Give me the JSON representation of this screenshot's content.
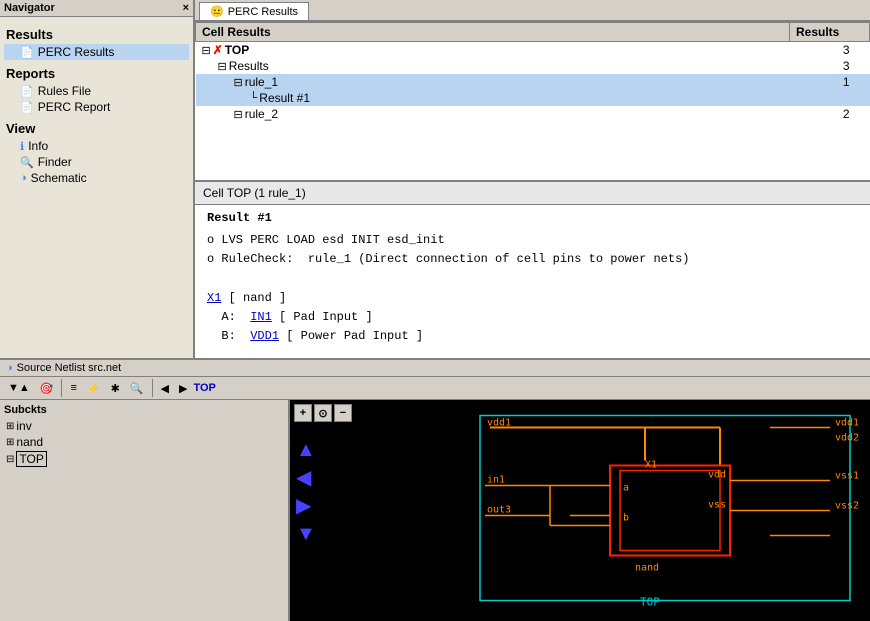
{
  "navigator": {
    "title": "Navigator",
    "close_label": "×",
    "sections": {
      "results_header": "Results",
      "results_items": [
        {
          "id": "perc-results",
          "label": "PERC Results",
          "indent": 1
        }
      ],
      "reports_header": "Reports",
      "reports_items": [
        {
          "id": "rules-file",
          "label": "Rules File",
          "indent": 1
        },
        {
          "id": "perc-report",
          "label": "PERC Report",
          "indent": 1
        }
      ],
      "view_header": "View",
      "view_items": [
        {
          "id": "info",
          "label": "Info",
          "icon": "ℹ",
          "indent": 1
        },
        {
          "id": "finder",
          "label": "Finder",
          "icon": "🔍",
          "indent": 1
        },
        {
          "id": "schematic",
          "label": "Schematic",
          "icon": "◑",
          "indent": 1
        }
      ]
    }
  },
  "perc_tab": {
    "icon": "😐",
    "label": "PERC Results"
  },
  "results_table": {
    "col_cell": "Cell Results",
    "col_results": "Results",
    "rows": [
      {
        "indent": 0,
        "expand": "⊟",
        "icon": "✗",
        "name": "TOP",
        "value": "3",
        "highlight": false,
        "bold": true
      },
      {
        "indent": 1,
        "expand": "⊟",
        "icon": "",
        "name": "Results",
        "value": "3",
        "highlight": false,
        "bold": false
      },
      {
        "indent": 2,
        "expand": "⊟",
        "icon": "",
        "name": "rule_1",
        "value": "1",
        "highlight": true,
        "bold": false
      },
      {
        "indent": 3,
        "expand": "└",
        "icon": "",
        "name": "Result #1",
        "value": "",
        "highlight": true,
        "bold": false
      },
      {
        "indent": 2,
        "expand": "⊟",
        "icon": "",
        "name": "rule_2",
        "value": "2",
        "highlight": false,
        "bold": false
      }
    ]
  },
  "cell_info": {
    "text": "Cell TOP (1 rule_1)"
  },
  "result_detail": {
    "title": "Result #1",
    "lines": [
      "o LVS PERC LOAD esd INIT esd_init",
      "o RuleCheck:  rule_1 (Direct connection of cell pins to power nets)",
      "",
      "X1 [ nand ]",
      "  A:  IN1 [ Pad Input ]",
      "  B:  VDD1 [ Power Pad Input ]"
    ],
    "link_texts": [
      "X1",
      "IN1",
      "VDD1"
    ]
  },
  "netlist_panel": {
    "title": "Source Netlist src.net",
    "title_icon": "◑"
  },
  "toolbar": {
    "buttons": [
      "▼▲",
      "🎯",
      "≡",
      "⚡",
      "✱",
      "🔍",
      "◀",
      "▶"
    ],
    "top_label": "TOP"
  },
  "subckt": {
    "title": "Subckts",
    "items": [
      {
        "label": "inv",
        "expand": "⊞",
        "selected": false
      },
      {
        "label": "nand",
        "expand": "⊞",
        "selected": false
      },
      {
        "label": "TOP",
        "expand": "⊟",
        "selected": true
      }
    ]
  },
  "schematic": {
    "labels": {
      "vdd1_left": "vdd1",
      "in1": "in1",
      "out3": "out3",
      "vdd1_right": "vdd1",
      "vdd2": "vdd2",
      "vss1": "vss1",
      "vss2": "vss2",
      "X1": "X1",
      "vdd_inner": "vdd",
      "vss_inner": "vss",
      "a": "a",
      "b": "b",
      "nand": "nand",
      "TOP": "TOP"
    },
    "colors": {
      "orange": "#ff8800",
      "red": "#ff2200",
      "cyan": "#00cccc",
      "yellow_green": "#aacc00"
    }
  },
  "zoom": {
    "zoom_in": "+",
    "zoom_fit": "⊙",
    "zoom_out": "−"
  },
  "arrows": {
    "up": "▲",
    "left": "◀",
    "right": "▶",
    "down": "▼"
  }
}
